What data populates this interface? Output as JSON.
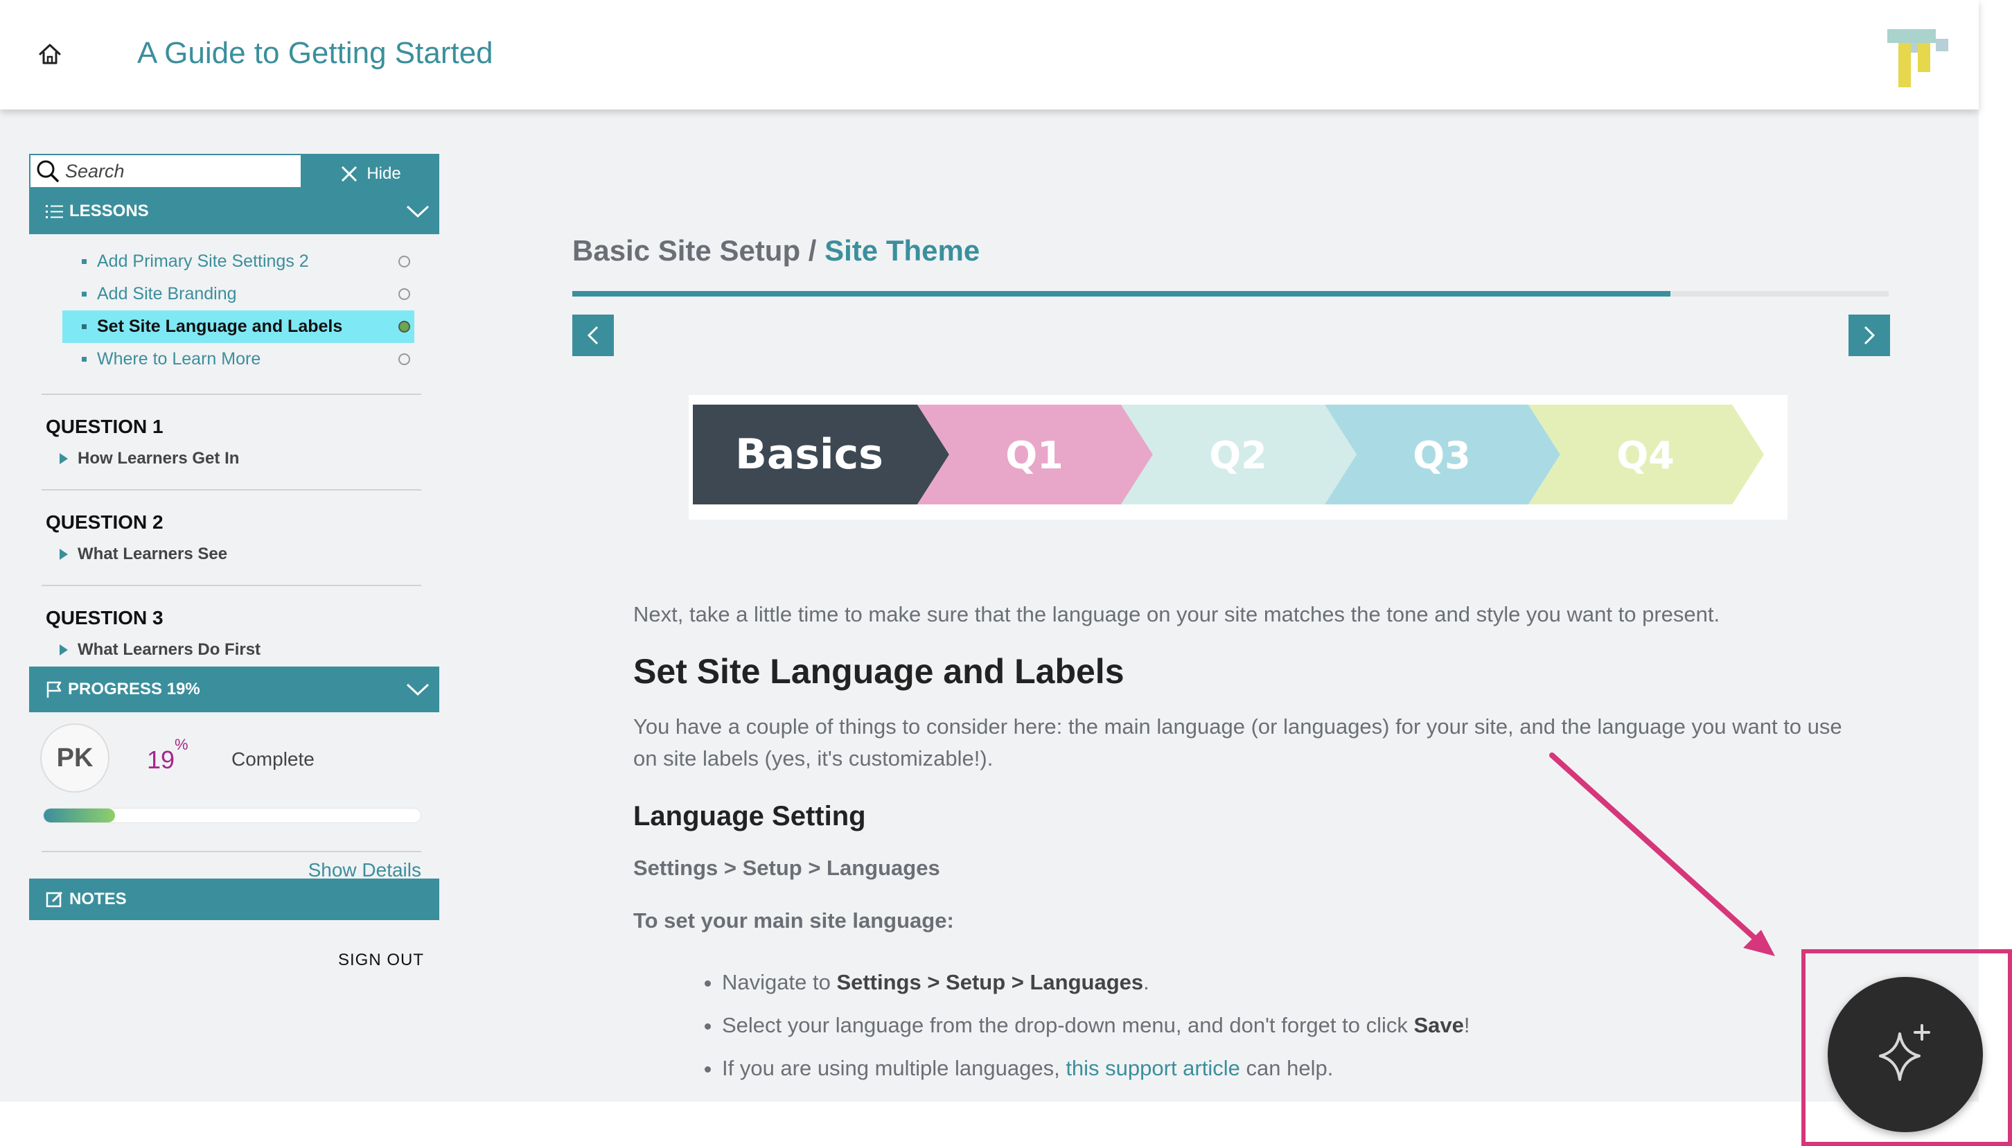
{
  "header": {
    "course_title": "A Guide to Getting Started"
  },
  "sidebar": {
    "search_placeholder": "Search",
    "hide_label": "Hide",
    "lessons_label": "LESSONS",
    "lessons": [
      {
        "label": "Add Primary Site Settings 2",
        "active": false
      },
      {
        "label": "Add Site Branding",
        "active": false
      },
      {
        "label": "Set Site Language and Labels",
        "active": true
      },
      {
        "label": "Where to Learn More",
        "active": false
      }
    ],
    "questions": [
      {
        "title": "QUESTION 1",
        "item": "How Learners Get In"
      },
      {
        "title": "QUESTION 2",
        "item": "What Learners See"
      },
      {
        "title": "QUESTION 3",
        "item": "What Learners Do First"
      }
    ],
    "progress_label": "PROGRESS 19%",
    "avatar_initials": "PK",
    "progress_value": "19",
    "progress_unit": "%",
    "progress_fraction": 0.19,
    "complete_label": "Complete",
    "show_details": "Show Details",
    "notes_label": "NOTES",
    "sign_out": "SIGN OUT"
  },
  "main": {
    "breadcrumb_parent": "Basic Site Setup / ",
    "breadcrumb_current": "Site Theme",
    "lesson_progress_fraction": 0.834,
    "banner": {
      "segments": [
        {
          "label": "Basics",
          "color": "#3d4852"
        },
        {
          "label": "Q1",
          "color": "#e8a7c8"
        },
        {
          "label": "Q2",
          "color": "#d3ece9"
        },
        {
          "label": "Q3",
          "color": "#aadbe4"
        },
        {
          "label": "Q4",
          "color": "#e4efb7"
        }
      ]
    },
    "intro": "Next, take a little time to make sure that the language on your site matches the tone and style you want to present.",
    "heading": "Set Site Language and Labels",
    "paragraph": "You have a couple of things to consider here: the main language (or languages) for your site, and the language you want to use on site labels (yes, it's customizable!).",
    "subheading": "Language Setting",
    "settings_path": "Settings > Setup > Languages",
    "set_main_label": "To set your main site language:",
    "steps": {
      "s1_pre": "Navigate to ",
      "s1_bold": "Settings > Setup > Languages",
      "s1_post": ".",
      "s2_pre": "Select your language from the drop-down menu, and don't forget to click ",
      "s2_bold": "Save",
      "s2_post": "!",
      "s3_pre": "If you are using multiple languages, ",
      "s3_link": "this support article",
      "s3_post": " can help."
    }
  },
  "colors": {
    "accent": "#3b8f9c",
    "highlight": "#7fe8f5",
    "annotation": "#d6367a",
    "percent": "#a5268d"
  },
  "icons": {
    "home": "home-icon",
    "search": "search-icon",
    "close": "close-icon",
    "list": "list-icon",
    "flag": "flag-icon",
    "notes": "edit-icon",
    "ai": "sparkle-icon"
  }
}
